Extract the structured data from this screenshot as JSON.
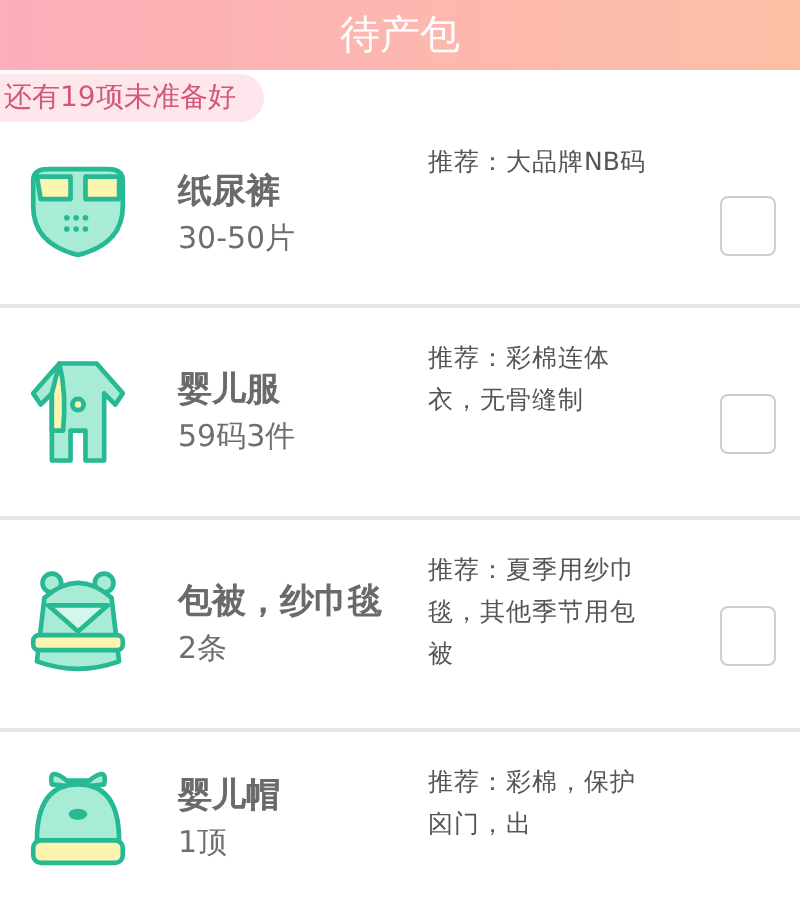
{
  "header": {
    "title": "待产包"
  },
  "remaining_badge": "还有19项未准备好",
  "items": [
    {
      "kind": "diaper",
      "name": "纸尿裤",
      "quantity": "30-50片",
      "note": "推荐：大品牌NB码",
      "checked": false
    },
    {
      "kind": "romper",
      "name": "婴儿服",
      "quantity": "59码3件",
      "note": "推荐：彩棉连体衣，无骨缝制",
      "checked": false
    },
    {
      "kind": "swaddle",
      "name": "包被，纱巾毯",
      "quantity": "2条",
      "note": "推荐：夏季用纱巾毯，其他季节用包被",
      "checked": false
    },
    {
      "kind": "hat",
      "name": "婴儿帽",
      "quantity": "1顶",
      "note": "推荐：彩棉，保护囟门，出"
    }
  ]
}
